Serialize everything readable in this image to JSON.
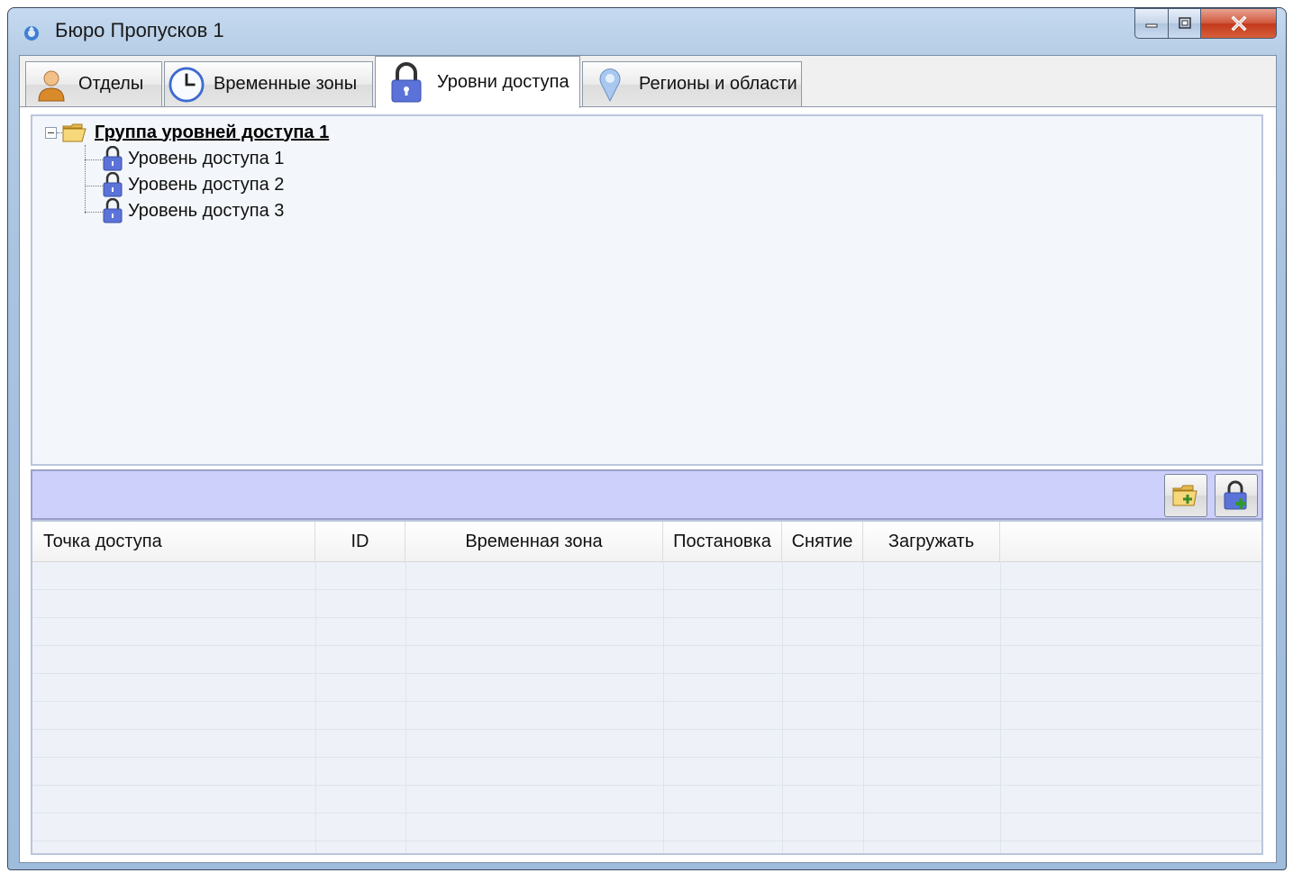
{
  "window": {
    "title": "Бюро Пропусков 1"
  },
  "tabs": [
    {
      "label": "Отделы",
      "icon": "person-icon"
    },
    {
      "label": "Временные зоны",
      "icon": "clock-icon"
    },
    {
      "label": "Уровни доступа",
      "icon": "padlock-icon",
      "active": true
    },
    {
      "label": "Регионы и области",
      "icon": "map-pin-icon"
    }
  ],
  "tree": {
    "group": {
      "label": "Группа уровней доступа 1",
      "expanded": true
    },
    "items": [
      {
        "label": "Уровень доступа 1"
      },
      {
        "label": "Уровень доступа 2"
      },
      {
        "label": "Уровень доступа 3"
      }
    ]
  },
  "toolbar": {
    "buttons": [
      {
        "name": "add-group-button",
        "icon": "folder-add-icon"
      },
      {
        "name": "add-access-level-button",
        "icon": "padlock-add-icon"
      }
    ]
  },
  "table": {
    "columns": [
      "Точка доступа",
      "ID",
      "Временная зона",
      "Постановка",
      "Снятие",
      "Загружать"
    ],
    "rows": []
  },
  "colors": {
    "toolbar_bg": "#cdd0fb",
    "tree_bg": "#f3f6fa",
    "grid_bg": "#eef2f8",
    "lock_blue": "#5b73d8"
  }
}
